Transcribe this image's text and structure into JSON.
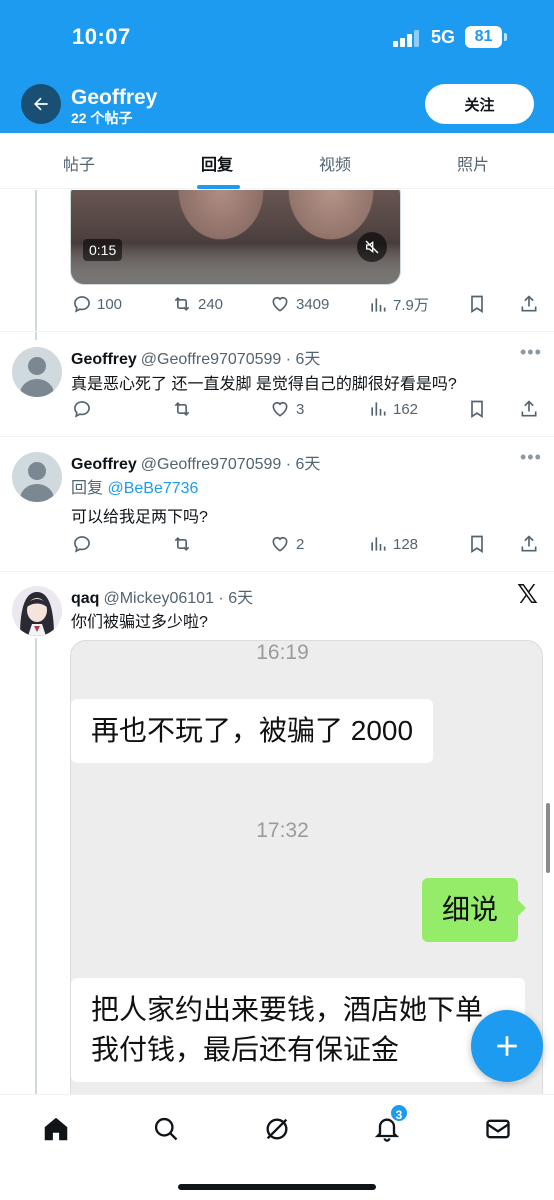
{
  "status_bar": {
    "time": "10:07",
    "network": "5G",
    "battery": "81"
  },
  "header": {
    "name": "Geoffrey",
    "post_count": "22 个帖子",
    "follow_label": "关注"
  },
  "tabs": [
    {
      "label": "帖子",
      "active": false
    },
    {
      "label": "回复",
      "active": true
    },
    {
      "label": "视频",
      "active": false
    },
    {
      "label": "照片",
      "active": false
    }
  ],
  "video_post": {
    "duration": "0:15",
    "stats": {
      "replies": "100",
      "retweets": "240",
      "likes": "3409",
      "views": "7.9万"
    }
  },
  "tweets": [
    {
      "name": "Geoffrey",
      "handle": "@Geoffre97070599 · 6天",
      "text": "真是恶心死了 还一直发脚 是觉得自己的脚很好看是吗?",
      "stats": {
        "replies": "",
        "retweets": "",
        "likes": "3",
        "views": "162"
      }
    },
    {
      "name": "Geoffrey",
      "handle": "@Geoffre97070599 · 6天",
      "reply_prefix": "回复",
      "reply_mention": "@BeBe7736",
      "text": "可以给我足两下吗?",
      "stats": {
        "replies": "",
        "retweets": "",
        "likes": "2",
        "views": "128"
      }
    },
    {
      "name": "qaq",
      "handle": "@Mickey06101 · 6天",
      "text": "你们被骗过多少啦?"
    }
  ],
  "chat_image": {
    "time1": "16:19",
    "msg1": "再也不玩了，被骗了 2000",
    "time2": "17:32",
    "msg2": "细说",
    "msg3_line1": "把人家约出来要钱，酒店她下单",
    "msg3_line2": "我付钱，最后还有保证金"
  },
  "bottom_nav": {
    "notifications_badge": "3"
  },
  "colors": {
    "accent": "#1d9bf0",
    "text": "#0f1419",
    "muted": "#536471",
    "wechat_green": "#95ec69"
  }
}
